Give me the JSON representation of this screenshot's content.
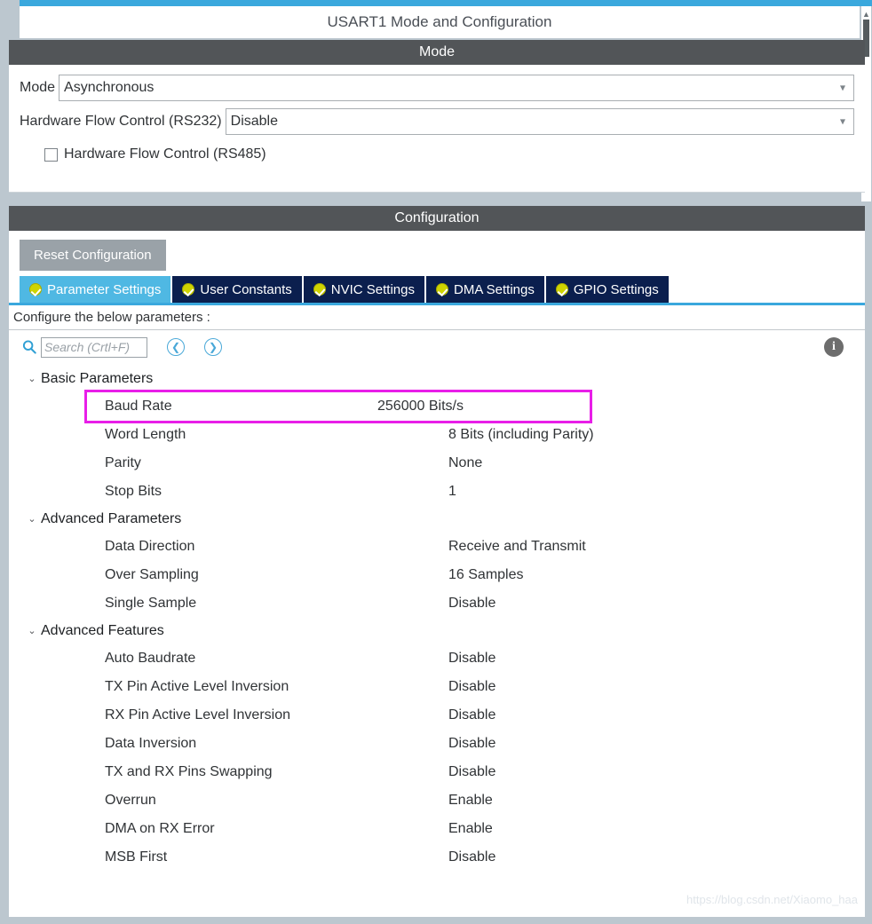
{
  "window": {
    "title": "USART1 Mode and Configuration"
  },
  "colors": {
    "accent_blue": "#3aa8dd",
    "tab_active": "#4fb8e3",
    "tab_inactive": "#0b1f4e",
    "section_header": "#525558",
    "highlight_magenta": "#e81ee8",
    "status_ok": "#cfd400"
  },
  "mode_section": {
    "header": "Mode",
    "fields": [
      {
        "label": "Mode",
        "value": "Asynchronous",
        "icon": "chevron-down-icon"
      },
      {
        "label": "Hardware Flow Control (RS232)",
        "value": "Disable",
        "icon": "chevron-down-icon"
      }
    ],
    "checkbox": {
      "label": "Hardware Flow Control (RS485)",
      "checked": false
    }
  },
  "config_section": {
    "header": "Configuration",
    "reset_label": "Reset Configuration",
    "tabs": [
      {
        "label": "Parameter Settings",
        "active": true,
        "status_icon": "check-circle-icon"
      },
      {
        "label": "User Constants",
        "active": false,
        "status_icon": "check-circle-icon"
      },
      {
        "label": "NVIC Settings",
        "active": false,
        "status_icon": "check-circle-icon"
      },
      {
        "label": "DMA Settings",
        "active": false,
        "status_icon": "check-circle-icon"
      },
      {
        "label": "GPIO Settings",
        "active": false,
        "status_icon": "check-circle-icon"
      }
    ],
    "configure_hint": "Configure the below parameters :",
    "search": {
      "placeholder": "Search (Crtl+F)",
      "value": "",
      "icon": "search-icon"
    },
    "nav_prev_icon": "chevron-left-circle-icon",
    "nav_next_icon": "chevron-right-circle-icon",
    "info_icon": "info-circle-icon",
    "groups": [
      {
        "name": "Basic Parameters",
        "expanded": true,
        "chevron": "chevron-down-icon",
        "rows": [
          {
            "name": "Baud Rate",
            "value": "256000 Bits/s",
            "highlighted": true
          },
          {
            "name": "Word Length",
            "value": "8 Bits (including Parity)",
            "highlighted": false
          },
          {
            "name": "Parity",
            "value": "None",
            "highlighted": false
          },
          {
            "name": "Stop Bits",
            "value": "1",
            "highlighted": false
          }
        ]
      },
      {
        "name": "Advanced Parameters",
        "expanded": true,
        "chevron": "chevron-down-icon",
        "rows": [
          {
            "name": "Data Direction",
            "value": "Receive and Transmit",
            "highlighted": false
          },
          {
            "name": "Over Sampling",
            "value": "16 Samples",
            "highlighted": false
          },
          {
            "name": "Single Sample",
            "value": "Disable",
            "highlighted": false
          }
        ]
      },
      {
        "name": "Advanced Features",
        "expanded": true,
        "chevron": "chevron-down-icon",
        "rows": [
          {
            "name": "Auto Baudrate",
            "value": "Disable",
            "highlighted": false
          },
          {
            "name": "TX Pin Active Level Inversion",
            "value": "Disable",
            "highlighted": false
          },
          {
            "name": "RX Pin Active Level Inversion",
            "value": "Disable",
            "highlighted": false
          },
          {
            "name": "Data Inversion",
            "value": "Disable",
            "highlighted": false
          },
          {
            "name": "TX and RX Pins Swapping",
            "value": "Disable",
            "highlighted": false
          },
          {
            "name": "Overrun",
            "value": "Enable",
            "highlighted": false
          },
          {
            "name": "DMA on RX Error",
            "value": "Enable",
            "highlighted": false
          },
          {
            "name": "MSB First",
            "value": "Disable",
            "highlighted": false
          }
        ]
      }
    ]
  },
  "watermark": "https://blog.csdn.net/Xiaomo_haa"
}
